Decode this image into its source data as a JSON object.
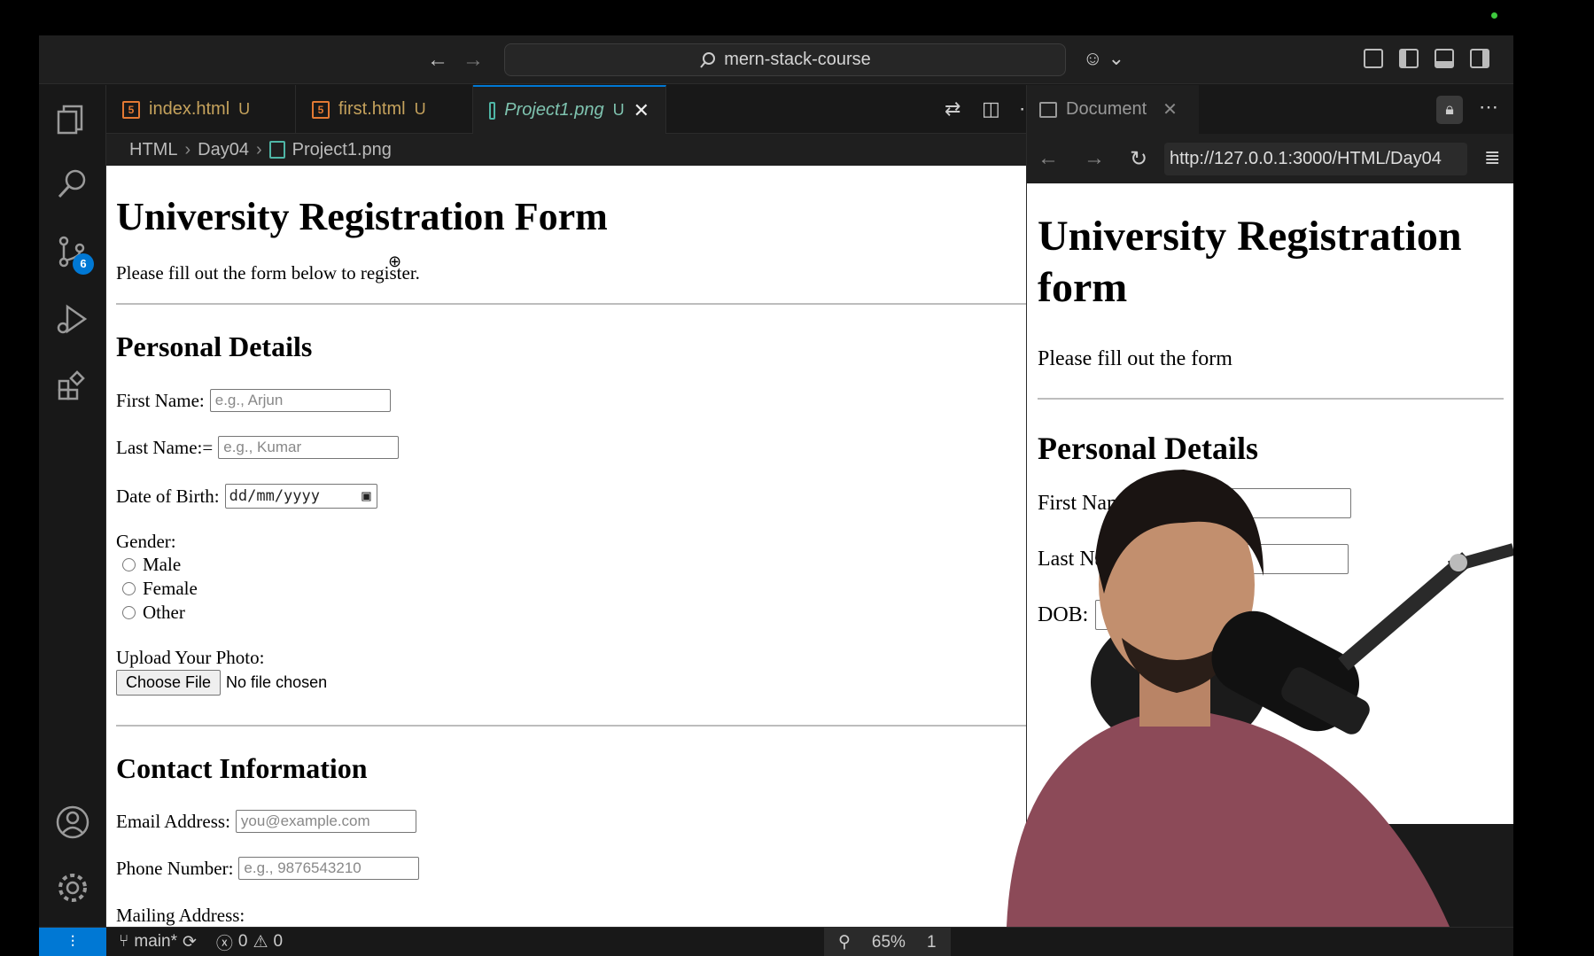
{
  "titlebar": {
    "search_text": "mern-stack-course"
  },
  "activity": {
    "scm_badge": "6"
  },
  "tabs": [
    {
      "label": "index.html",
      "mod": "U"
    },
    {
      "label": "first.html",
      "mod": "U"
    },
    {
      "label": "Project1.png",
      "mod": "U"
    }
  ],
  "breadcrumb": [
    "HTML",
    "Day04",
    "Project1.png"
  ],
  "preview": {
    "title": "University Registration Form",
    "intro": "Please fill out the form below to register.",
    "section1": "Personal Details",
    "first_name_label": "First Name:",
    "first_name_placeholder": "e.g., Arjun",
    "last_name_label": "Last Name:=",
    "last_name_placeholder": "e.g., Kumar",
    "dob_label": "Date of Birth:",
    "dob_placeholder": "dd/mm/yyyy",
    "gender_label": "Gender:",
    "gender_options": [
      "Male",
      "Female",
      "Other"
    ],
    "photo_label": "Upload Your Photo:",
    "choose_file": "Choose File",
    "no_file": "No file chosen",
    "section2": "Contact Information",
    "email_label": "Email Address:",
    "email_placeholder": "you@example.com",
    "phone_label": "Phone Number:",
    "phone_placeholder": "e.g., 9876543210",
    "mailing_label": "Mailing Address:"
  },
  "browser": {
    "tab_title": "Document",
    "url": "http://127.0.0.1:3000/HTML/Day04",
    "title": "University Registration form",
    "intro": "Please fill out the form",
    "section1": "Personal Details",
    "first_name_label": "First Name:",
    "last_name_label": "Last Name:",
    "dob_label": "DOB:"
  },
  "statusbar": {
    "branch": "main*",
    "errors": "0",
    "warnings": "0",
    "zoom": "65%",
    "partial": "1"
  }
}
